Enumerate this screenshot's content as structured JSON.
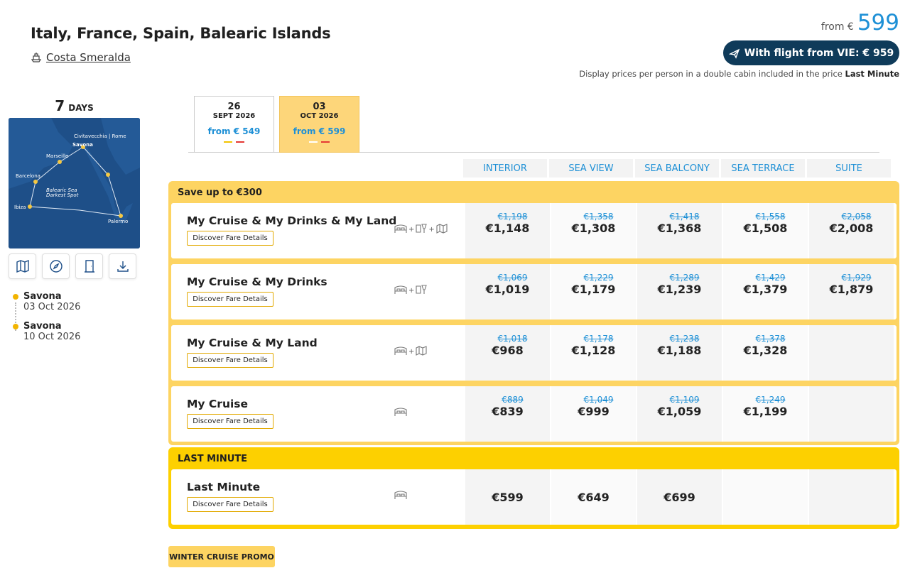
{
  "header": {
    "title": "Italy, France, Spain, Balearic Islands",
    "ship_name": "Costa Smeralda",
    "from_label": "from €",
    "from_price": "599",
    "flight_button": "With flight from VIE: € 959",
    "note_prefix": "Display prices per person in a double cabin included in the price",
    "note_bold": "Last Minute"
  },
  "left": {
    "days_num": "7",
    "days_label": "DAYS",
    "map_labels": {
      "civitavecchia": "Civitavecchia | Rome",
      "savona": "Savona",
      "marseille": "Marseille",
      "barcelona": "Barcelona",
      "balearic": "Balearic Sea",
      "darkest": "Darkest Spot",
      "ibiza": "Ibiza",
      "palermo": "Palermo"
    },
    "itinerary": [
      {
        "port": "Savona",
        "date": "03 Oct 2026"
      },
      {
        "port": "Savona",
        "date": "10 Oct 2026"
      }
    ]
  },
  "date_tabs": [
    {
      "day": "26",
      "month": "SEPT 2026",
      "price": "from € 549",
      "active": false
    },
    {
      "day": "03",
      "month": "OCT 2026",
      "price": "from € 599",
      "active": true
    }
  ],
  "cabins": [
    "INTERIOR",
    "SEA VIEW",
    "SEA BALCONY",
    "SEA TERRACE",
    "SUITE"
  ],
  "groups": {
    "save": {
      "title": "Save up to €300",
      "fares": [
        {
          "name": "My Cruise & My Drinks & My Land",
          "button": "Discover Fare Details",
          "prices": [
            [
              "€1,198",
              "€1,148"
            ],
            [
              "€1,358",
              "€1,308"
            ],
            [
              "€1,418",
              "€1,368"
            ],
            [
              "€1,558",
              "€1,508"
            ],
            [
              "€2,058",
              "€2,008"
            ]
          ]
        },
        {
          "name": "My Cruise & My Drinks",
          "button": "Discover Fare Details",
          "prices": [
            [
              "€1,069",
              "€1,019"
            ],
            [
              "€1,229",
              "€1,179"
            ],
            [
              "€1,289",
              "€1,239"
            ],
            [
              "€1,429",
              "€1,379"
            ],
            [
              "€1,929",
              "€1,879"
            ]
          ]
        },
        {
          "name": "My Cruise & My Land",
          "button": "Discover Fare Details",
          "prices": [
            [
              "€1,018",
              "€968"
            ],
            [
              "€1,178",
              "€1,128"
            ],
            [
              "€1,238",
              "€1,188"
            ],
            [
              "€1,378",
              "€1,328"
            ],
            [
              "",
              ""
            ]
          ]
        },
        {
          "name": "My Cruise",
          "button": "Discover Fare Details",
          "prices": [
            [
              "€889",
              "€839"
            ],
            [
              "€1,049",
              "€999"
            ],
            [
              "€1,109",
              "€1,059"
            ],
            [
              "€1,249",
              "€1,199"
            ],
            [
              "",
              ""
            ]
          ]
        }
      ]
    },
    "last_minute": {
      "title": "LAST MINUTE",
      "fares": [
        {
          "name": "Last Minute",
          "button": "Discover Fare Details",
          "prices": [
            "€599",
            "€649",
            "€699",
            "",
            ""
          ]
        }
      ]
    }
  },
  "promo_label": "WINTER CRUISE PROMO",
  "colors": {
    "accent_blue": "#1e90d6",
    "navy": "#0f3b5a",
    "yellow": "#fdd462",
    "yellow_strong": "#fdd000"
  }
}
